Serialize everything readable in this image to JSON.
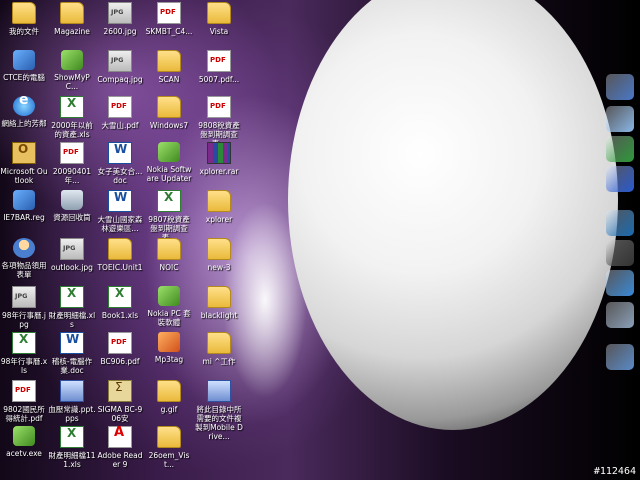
{
  "desktop": {
    "icons": [
      {
        "label": "我的文件",
        "icon": "my-documents-icon"
      },
      {
        "label": "Magazine",
        "icon": "folder-icon"
      },
      {
        "label": "2600.jpg",
        "icon": "jpg-file-icon"
      },
      {
        "label": "SKMBT_C4...",
        "icon": "pdf-file-icon"
      },
      {
        "label": "Vista",
        "icon": "folder-icon"
      },
      {
        "label": "CTCE的電腦",
        "icon": "my-computer-icon"
      },
      {
        "label": "ShowMyPC...",
        "icon": "app-icon"
      },
      {
        "label": "Compaq.jpg",
        "icon": "jpg-file-icon"
      },
      {
        "label": "SCAN",
        "icon": "folder-icon"
      },
      {
        "label": "5007.pdf...",
        "icon": "pdf-file-icon"
      },
      {
        "label": "網絡上的芳鄰",
        "icon": "network-icon"
      },
      {
        "label": "2000年以前的資產.xls",
        "icon": "excel-file-icon"
      },
      {
        "label": "大雪山.pdf",
        "icon": "pdf-file-icon"
      },
      {
        "label": "Windows7",
        "icon": "folder-icon"
      },
      {
        "label": "9808稅資產盤到期調查表...",
        "icon": "pdf-file-icon"
      },
      {
        "label": "Microsoft Outlook",
        "icon": "outlook-icon"
      },
      {
        "label": "20090401年...",
        "icon": "pdf-file-icon"
      },
      {
        "label": "女子美女合...doc",
        "icon": "word-file-icon"
      },
      {
        "label": "Nokia Software Updater",
        "icon": "app-icon"
      },
      {
        "label": "xplorer.rar",
        "icon": "rar-file-icon"
      },
      {
        "label": "IE7BAR.reg",
        "icon": "registry-icon"
      },
      {
        "label": "資源回收筒",
        "icon": "recycle-bin-icon"
      },
      {
        "label": "大雪山國家森林遊樂區...",
        "icon": "word-file-icon"
      },
      {
        "label": "9807稅資產盤到期調查表...",
        "icon": "excel-file-icon"
      },
      {
        "label": "xplorer",
        "icon": "folder-icon"
      },
      {
        "label": "各項物品領用表單",
        "icon": "user-icon"
      },
      {
        "label": "outlook.jpg",
        "icon": "jpg-file-icon"
      },
      {
        "label": "TOEIC.Unit1",
        "icon": "folder-icon"
      },
      {
        "label": "NOIC",
        "icon": "folder-icon"
      },
      {
        "label": "new-3",
        "icon": "folder-icon"
      },
      {
        "label": "98年行事曆.jpg",
        "icon": "jpg-file-icon"
      },
      {
        "label": "財產明細檔.xls",
        "icon": "excel-file-icon"
      },
      {
        "label": "Book1.xls",
        "icon": "excel-file-icon"
      },
      {
        "label": "Nokia PC 套裝軟體",
        "icon": "app-icon"
      },
      {
        "label": "blacklight",
        "icon": "folder-icon"
      },
      {
        "label": "98年行事曆.xls",
        "icon": "excel-file-icon"
      },
      {
        "label": "稽核-電腦作業.doc",
        "icon": "word-file-icon"
      },
      {
        "label": "BC906.pdf",
        "icon": "pdf-file-icon"
      },
      {
        "label": "Mp3tag",
        "icon": "mp3tag-icon"
      },
      {
        "label": "mi ^工作",
        "icon": "folder-icon"
      },
      {
        "label": "9802國民所得統計.pdf",
        "icon": "pdf-file-icon"
      },
      {
        "label": "血壓常識.ppt.pps",
        "icon": "document-icon"
      },
      {
        "label": "SIGMA BC-906安",
        "icon": "sigma-icon"
      },
      {
        "label": "g.gif",
        "icon": "folder-icon"
      },
      {
        "label": "將此目錄中所需要的文件複製到Mobile Drive...",
        "icon": "document-icon"
      },
      {
        "label": "acetv.exe",
        "icon": "app-icon"
      },
      {
        "label": "財產明細檔111.xls",
        "icon": "excel-file-icon"
      },
      {
        "label": "Adobe Reader 9",
        "icon": "acrobat-icon"
      },
      {
        "label": "26oem_Vist...",
        "icon": "folder-icon"
      },
      {
        "label": "",
        "icon": ""
      }
    ]
  },
  "dock": {
    "items": [
      {
        "icon": "monitor-icon",
        "color": "#4a78c8"
      },
      {
        "icon": "window-icon",
        "color": "#8ab8e8"
      },
      {
        "icon": "excel-app-icon",
        "color": "#2e9a3a"
      },
      {
        "icon": "word-app-icon",
        "color": "#2a5ad0"
      },
      {
        "icon": "media-player-icon",
        "color": "#1a6ab0"
      },
      {
        "icon": "film-icon",
        "color": "#333333"
      },
      {
        "icon": "outlook-app-icon",
        "color": "#3a8ad8"
      },
      {
        "icon": "tools-icon",
        "color": "#8aa0b8"
      },
      {
        "icon": "settings-icon",
        "color": "#5a8ac8"
      }
    ]
  },
  "watermark": "#112464"
}
